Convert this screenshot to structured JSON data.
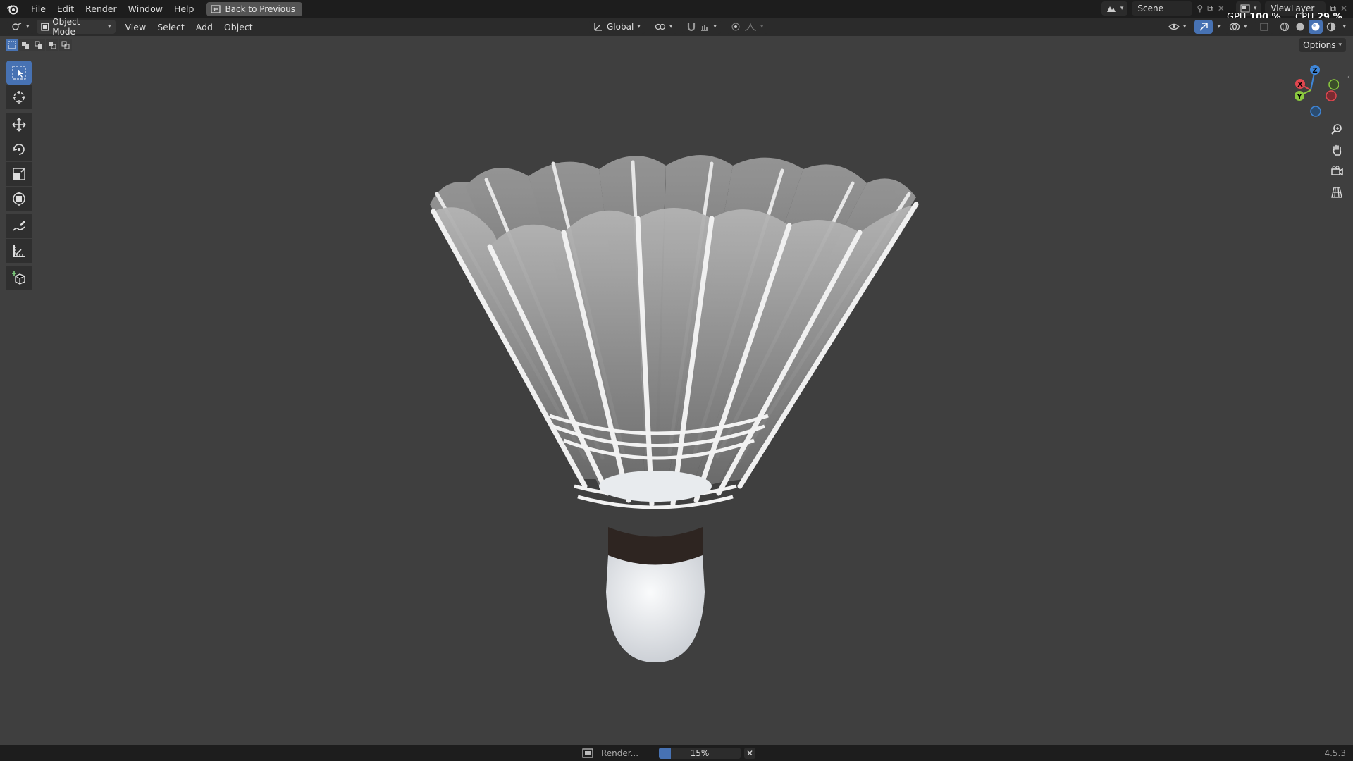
{
  "topbar": {
    "menus": [
      "File",
      "Edit",
      "Render",
      "Window",
      "Help"
    ],
    "back_button": "Back to Previous",
    "scene": "Scene",
    "view_layer": "ViewLayer",
    "gpu_label": "GPU",
    "gpu_value": "100 %",
    "cpu_label": "CPU",
    "cpu_value": "29 %"
  },
  "header": {
    "mode": "Object Mode",
    "menus": [
      "View",
      "Select",
      "Add",
      "Object"
    ],
    "orientation": "Global"
  },
  "viewport": {
    "options": "Options",
    "gizmo_axes": [
      "X",
      "Y",
      "Z"
    ],
    "background_color": "#3f3f3f"
  },
  "tools": [
    "select-box",
    "cursor",
    "move",
    "rotate",
    "scale",
    "transform",
    "annotate",
    "measure",
    "add-cube"
  ],
  "status": {
    "render_label": "Render...",
    "progress_text": "15%",
    "progress_fraction": 0.15,
    "version": "4.5.3"
  },
  "colors": {
    "accent": "#4772b3",
    "axis_x": "#e0474f",
    "axis_y": "#8bc93f",
    "axis_z": "#3f86d8"
  }
}
